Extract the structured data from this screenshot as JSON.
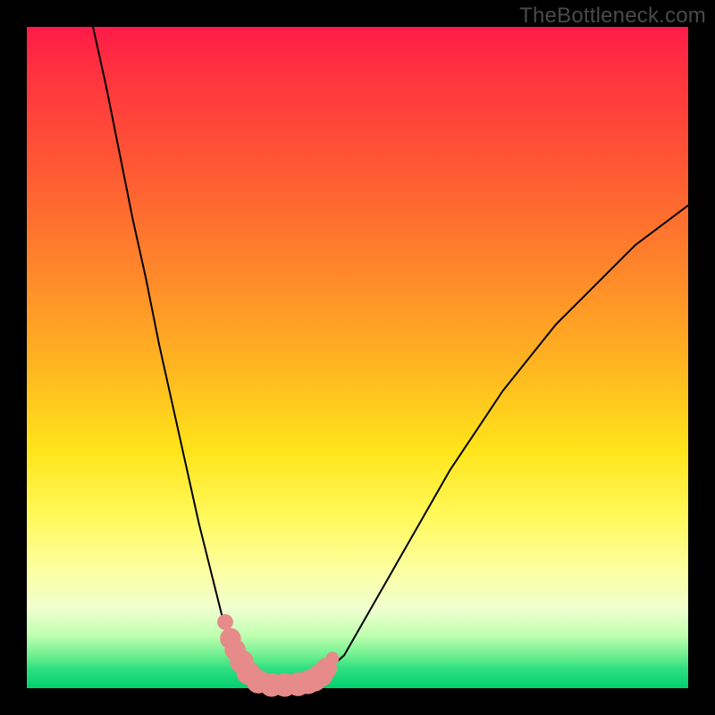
{
  "watermark": "TheBottleneck.com",
  "chart_data": {
    "type": "line",
    "title": "",
    "xlabel": "",
    "ylabel": "",
    "xlim": [
      0,
      100
    ],
    "ylim": [
      0,
      100
    ],
    "grid": false,
    "series": [
      {
        "name": "left-curve",
        "x": [
          10,
          12,
          14,
          16,
          18,
          20,
          22,
          24,
          26,
          28,
          30,
          31,
          32,
          33,
          34,
          35,
          36
        ],
        "values": [
          100,
          91,
          81,
          71,
          62,
          52,
          43,
          34,
          25,
          17,
          9,
          6,
          4,
          2.5,
          1.5,
          1,
          0.6
        ]
      },
      {
        "name": "valley-floor",
        "x": [
          34,
          36,
          38,
          40,
          42,
          44
        ],
        "values": [
          1.5,
          0.6,
          0.4,
          0.5,
          0.7,
          1.4
        ]
      },
      {
        "name": "right-curve",
        "x": [
          42,
          44,
          48,
          52,
          56,
          60,
          64,
          68,
          72,
          76,
          80,
          84,
          88,
          92,
          96,
          100
        ],
        "values": [
          0.7,
          1.4,
          5,
          12,
          19,
          26,
          33,
          39,
          45,
          50,
          55,
          59,
          63,
          67,
          70,
          73
        ]
      }
    ],
    "markers": {
      "name": "valley-markers",
      "color": "#e68a8a",
      "points": [
        {
          "x": 30.0,
          "y": 10.0,
          "r": 1.2
        },
        {
          "x": 30.8,
          "y": 7.5,
          "r": 1.6
        },
        {
          "x": 31.5,
          "y": 5.8,
          "r": 1.6
        },
        {
          "x": 32.5,
          "y": 4.0,
          "r": 1.8
        },
        {
          "x": 33.5,
          "y": 2.3,
          "r": 1.8
        },
        {
          "x": 35.0,
          "y": 1.0,
          "r": 1.8
        },
        {
          "x": 37.0,
          "y": 0.5,
          "r": 1.8
        },
        {
          "x": 39.0,
          "y": 0.5,
          "r": 1.8
        },
        {
          "x": 41.0,
          "y": 0.6,
          "r": 1.8
        },
        {
          "x": 42.5,
          "y": 0.9,
          "r": 1.8
        },
        {
          "x": 43.5,
          "y": 1.3,
          "r": 1.8
        },
        {
          "x": 44.5,
          "y": 2.0,
          "r": 1.8
        },
        {
          "x": 45.3,
          "y": 3.0,
          "r": 1.6
        },
        {
          "x": 46.2,
          "y": 4.5,
          "r": 1.0
        }
      ]
    },
    "background_gradient": {
      "top": "#ff1a49",
      "mid": "#ffe41a",
      "bottom": "#00d070"
    }
  }
}
